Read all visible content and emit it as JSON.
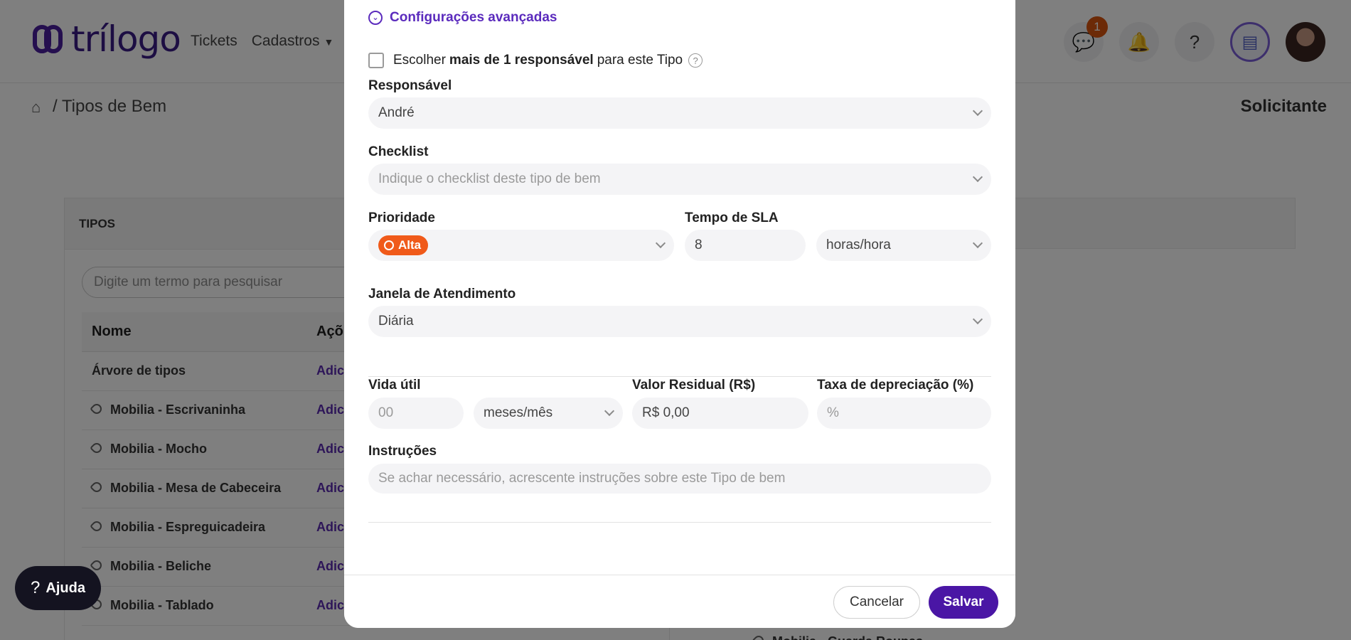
{
  "app": {
    "logo_text": "trílogo",
    "nav": [
      "Tickets",
      "Cadastros"
    ],
    "notification_count": "1"
  },
  "breadcrumb": {
    "current": "Tipos de Bem",
    "right_label": "Solicitante"
  },
  "types_panel": {
    "header": "TIPOS",
    "search_placeholder": "Digite um termo para pesquisar",
    "columns": [
      "Nome",
      "Açõ"
    ],
    "rows": [
      {
        "name": "Árvore de tipos",
        "action": "Adici"
      },
      {
        "name": "Mobilia - Escrivaninha",
        "action": "Adici"
      },
      {
        "name": "Mobilia - Mocho",
        "action": "Adici"
      },
      {
        "name": "Mobilia - Mesa de Cabeceira",
        "action": "Adici"
      },
      {
        "name": "Mobilia - Espreguicadeira",
        "action": "Adici"
      },
      {
        "name": "Mobilia - Beliche",
        "action": "Adici"
      },
      {
        "name": "Mobilia - Tablado",
        "action": "Adici"
      }
    ],
    "bottom_right_item": "Mobilia - Guarda Roupas"
  },
  "help_button": {
    "label": "Ajuda"
  },
  "modal": {
    "advanced_link": "Configurações avançadas",
    "multi_responsible": {
      "prefix": "Escolher",
      "bold": "mais de 1 responsável",
      "suffix": "para este Tipo"
    },
    "responsavel": {
      "label": "Responsável",
      "value": "André"
    },
    "checklist": {
      "label": "Checklist",
      "placeholder": "Indique o checklist deste tipo de bem"
    },
    "prioridade": {
      "label": "Prioridade",
      "value": "Alta",
      "color": "#f05a1a"
    },
    "sla": {
      "label": "Tempo de SLA",
      "value": "8",
      "unit": "horas/hora"
    },
    "janela": {
      "label": "Janela de Atendimento",
      "value": "Diária"
    },
    "vida_util": {
      "label": "Vida útil",
      "placeholder": "00",
      "unit": "meses/mês"
    },
    "valor_residual": {
      "label": "Valor Residual (R$)",
      "value": "R$ 0,00"
    },
    "taxa": {
      "label": "Taxa de depreciação (%)",
      "placeholder": "%"
    },
    "instrucoes": {
      "label": "Instruções",
      "placeholder": "Se achar necessário, acrescente instruções sobre este Tipo de bem"
    },
    "buttons": {
      "cancel": "Cancelar",
      "save": "Salvar"
    },
    "accent_color": "#4a16a5"
  }
}
